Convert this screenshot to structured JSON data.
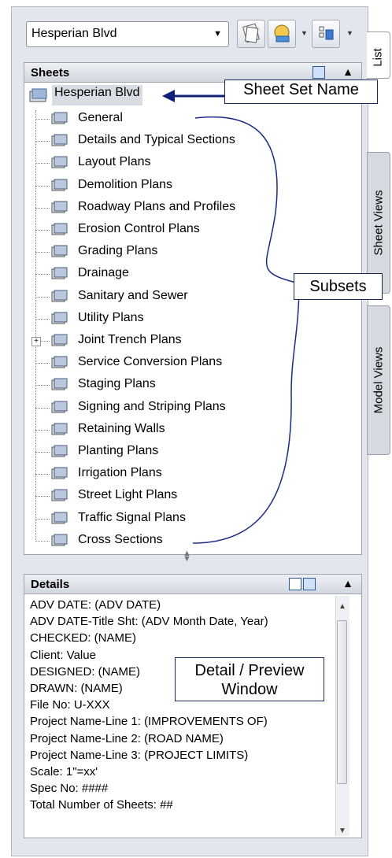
{
  "combo": {
    "value": "Hesperian Blvd",
    "arrow_icon": "chevron-down-icon"
  },
  "toolbar": {
    "buttons": [
      {
        "icon": "sheet-set-icon"
      },
      {
        "icon": "publish-icon"
      },
      {
        "icon": "view-options-icon"
      }
    ]
  },
  "sheets_panel": {
    "title": "Sheets"
  },
  "tree": {
    "root": "Hesperian Blvd",
    "items": [
      {
        "label": "General"
      },
      {
        "label": "Details and Typical Sections"
      },
      {
        "label": "Layout Plans"
      },
      {
        "label": "Demolition Plans"
      },
      {
        "label": "Roadway Plans and Profiles"
      },
      {
        "label": "Erosion Control Plans"
      },
      {
        "label": "Grading Plans"
      },
      {
        "label": "Drainage"
      },
      {
        "label": "Sanitary and Sewer"
      },
      {
        "label": "Utility Plans"
      },
      {
        "label": "Joint Trench Plans",
        "expander": "+"
      },
      {
        "label": "Service Conversion Plans"
      },
      {
        "label": "Staging Plans"
      },
      {
        "label": "Signing and Striping Plans"
      },
      {
        "label": "Retaining Walls"
      },
      {
        "label": "Planting Plans"
      },
      {
        "label": "Irrigation Plans"
      },
      {
        "label": "Street Light Plans"
      },
      {
        "label": "Traffic Signal Plans"
      },
      {
        "label": "Cross Sections"
      }
    ]
  },
  "details_panel": {
    "title": "Details",
    "lines": [
      "ADV DATE: (ADV DATE)",
      "ADV DATE-Title Sht: (ADV Month Date, Year)",
      "CHECKED: (NAME)",
      "Client: Value",
      "DESIGNED: (NAME)",
      "DRAWN: (NAME)",
      "File No: U-XXX",
      "Project Name-Line 1: (IMPROVEMENTS OF)",
      "Project Name-Line 2: (ROAD NAME)",
      "Project Name-Line 3: (PROJECT LIMITS)",
      "Scale: 1\"=xx'",
      "Spec No: ####",
      "Total Number of Sheets: ##"
    ]
  },
  "side_tabs": {
    "list": "List",
    "sheet_views": "Sheet Views",
    "model_views": "Model Views"
  },
  "callouts": {
    "sheet_set_name": "Sheet Set Name",
    "subsets": "Subsets",
    "detail_preview_1": "Detail / Preview",
    "detail_preview_2": "Window"
  },
  "colors": {
    "callout_border": "#1a2a5e",
    "arrow": "#10207a",
    "palette_bg": "#e3e6ec"
  }
}
